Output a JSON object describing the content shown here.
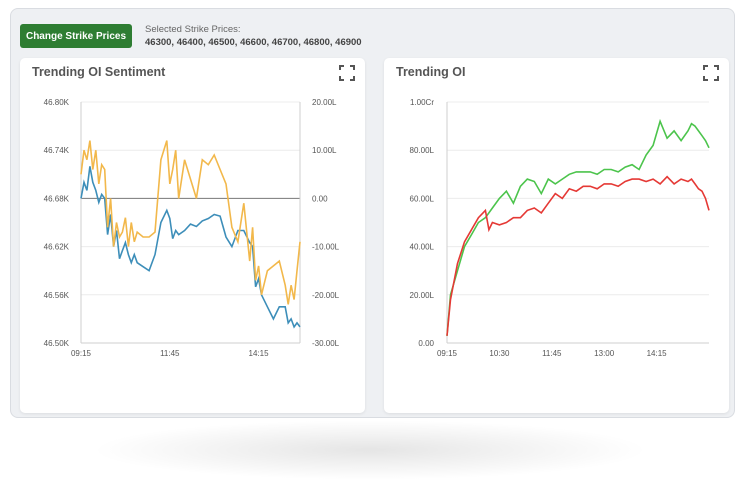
{
  "toolbar": {
    "change_button_label": "Change Strike Prices",
    "selected_label": "Selected Strike Prices:",
    "selected_values": "46300, 46400, 46500, 46600, 46700, 46800, 46900"
  },
  "icons": {
    "expand": "expand-icon"
  },
  "colors": {
    "button": "#2e7d32",
    "blue_series": "#3d8eb9",
    "orange_series": "#f2b84b",
    "green_series": "#4cc44c",
    "red_series": "#e53935"
  },
  "chart_data": [
    {
      "type": "line",
      "title": "Trending OI Sentiment",
      "x_ticks": [
        "09:15",
        "11:45",
        "14:15"
      ],
      "y_left_ticks": [
        "46.80K",
        "46.74K",
        "46.68K",
        "46.62K",
        "46.56K",
        "46.50K"
      ],
      "y_right_ticks": [
        "20.00L",
        "10.00L",
        "0.00",
        "-10.00L",
        "-20.00L",
        "-30.00L"
      ],
      "ylim_left": [
        46500,
        46800
      ],
      "ylim_right": [
        -30,
        20
      ],
      "x_range_minutes": [
        555,
        925
      ],
      "series": [
        {
          "axis": "left",
          "color": "#3d8eb9",
          "x": [
            555,
            560,
            565,
            570,
            575,
            580,
            585,
            590,
            595,
            600,
            605,
            610,
            615,
            620,
            625,
            630,
            635,
            640,
            645,
            650,
            660,
            670,
            680,
            690,
            700,
            705,
            710,
            715,
            720,
            730,
            740,
            750,
            760,
            770,
            780,
            790,
            800,
            810,
            820,
            830,
            840,
            845,
            850,
            855,
            860,
            870,
            880,
            890,
            900,
            905,
            910,
            915,
            920,
            925
          ],
          "y": [
            46680,
            46700,
            46690,
            46720,
            46700,
            46690,
            46675,
            46685,
            46680,
            46635,
            46660,
            46620,
            46640,
            46605,
            46615,
            46625,
            46610,
            46600,
            46610,
            46600,
            46595,
            46590,
            46610,
            46650,
            46665,
            46655,
            46630,
            46640,
            46635,
            46640,
            46648,
            46645,
            46652,
            46655,
            46660,
            46658,
            46632,
            46620,
            46640,
            46640,
            46625,
            46620,
            46570,
            46580,
            46560,
            46545,
            46530,
            46545,
            46545,
            46525,
            46530,
            46520,
            46525,
            46520
          ]
        },
        {
          "axis": "right",
          "color": "#f2b84b",
          "x": [
            555,
            560,
            565,
            570,
            575,
            580,
            585,
            590,
            595,
            600,
            605,
            610,
            615,
            620,
            625,
            630,
            635,
            640,
            645,
            650,
            660,
            670,
            680,
            690,
            700,
            705,
            710,
            715,
            720,
            730,
            740,
            750,
            760,
            770,
            780,
            790,
            800,
            810,
            820,
            830,
            840,
            845,
            850,
            855,
            860,
            870,
            880,
            890,
            900,
            905,
            910,
            915,
            920,
            925
          ],
          "y": [
            5,
            10,
            8,
            12,
            6,
            10,
            3,
            7,
            6,
            -6,
            0,
            -10,
            -5,
            -8,
            -7,
            -4,
            -10,
            -5,
            -9,
            -7,
            -8,
            -8,
            -7,
            8,
            12,
            3,
            6,
            10,
            0,
            8,
            4,
            0,
            8,
            7,
            9,
            6,
            3,
            -6,
            -9,
            -1,
            -13,
            -6,
            -17,
            -14,
            -20,
            -15,
            -14,
            -13,
            -18,
            -22,
            -18,
            -21,
            -15,
            -9
          ]
        }
      ]
    },
    {
      "type": "line",
      "title": "Trending OI",
      "x_ticks": [
        "09:15",
        "10:30",
        "11:45",
        "13:00",
        "14:15"
      ],
      "y_ticks": [
        "1.00Cr",
        "80.00L",
        "60.00L",
        "40.00L",
        "20.00L",
        "0.00"
      ],
      "ylim": [
        0,
        100
      ],
      "x_range_minutes": [
        555,
        930
      ],
      "series": [
        {
          "color": "#4cc44c",
          "x": [
            555,
            560,
            570,
            580,
            590,
            600,
            610,
            620,
            630,
            640,
            650,
            660,
            670,
            680,
            690,
            700,
            710,
            720,
            730,
            740,
            750,
            760,
            770,
            780,
            790,
            800,
            810,
            820,
            830,
            840,
            850,
            860,
            870,
            880,
            890,
            900,
            905,
            910,
            915,
            920,
            925,
            930
          ],
          "y": [
            3,
            20,
            30,
            40,
            45,
            50,
            52,
            56,
            60,
            63,
            58,
            65,
            68,
            67,
            62,
            68,
            66,
            68,
            70,
            71,
            71,
            71,
            70,
            72,
            72,
            71,
            73,
            74,
            72,
            78,
            82,
            92,
            85,
            88,
            84,
            88,
            91,
            90,
            88,
            86,
            84,
            81
          ]
        },
        {
          "color": "#e53935",
          "x": [
            555,
            560,
            570,
            580,
            590,
            600,
            610,
            615,
            620,
            630,
            640,
            650,
            660,
            670,
            680,
            690,
            700,
            710,
            720,
            730,
            740,
            750,
            760,
            770,
            780,
            790,
            800,
            810,
            820,
            830,
            840,
            850,
            860,
            870,
            880,
            890,
            900,
            905,
            910,
            915,
            920,
            925,
            930
          ],
          "y": [
            3,
            18,
            33,
            42,
            47,
            52,
            55,
            47,
            50,
            49,
            50,
            52,
            52,
            55,
            56,
            54,
            58,
            62,
            60,
            64,
            63,
            65,
            65,
            64,
            66,
            66,
            65,
            67,
            68,
            68,
            67,
            68,
            66,
            69,
            66,
            68,
            67,
            68,
            66,
            64,
            63,
            60,
            55
          ]
        }
      ]
    }
  ]
}
